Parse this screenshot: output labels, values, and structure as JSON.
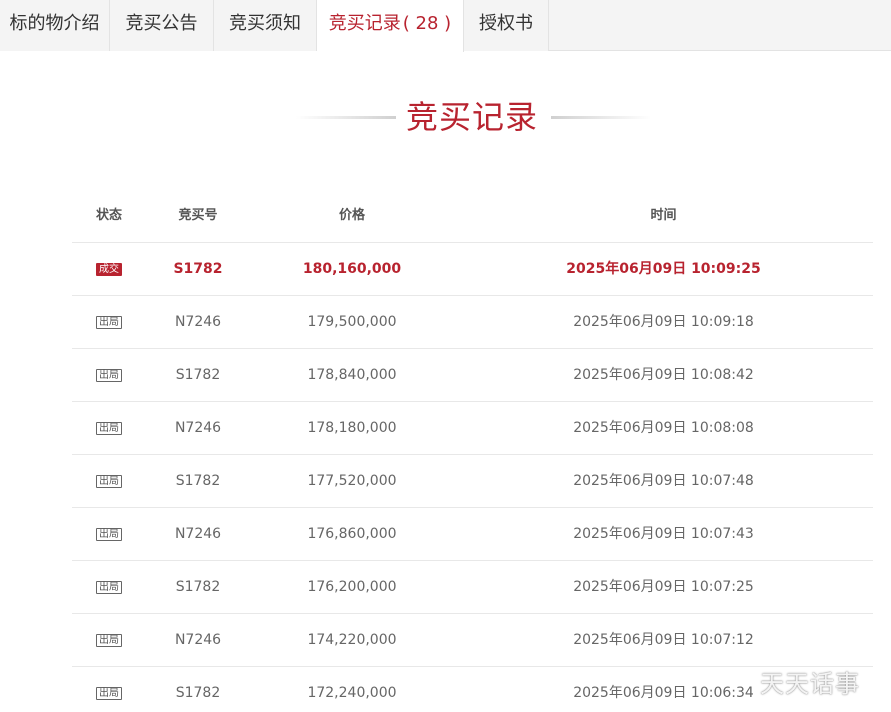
{
  "tabs": [
    {
      "label": "标的物介绍",
      "count": ""
    },
    {
      "label": "竞买公告",
      "count": ""
    },
    {
      "label": "竞买须知",
      "count": ""
    },
    {
      "label": "竞买记录",
      "count": "( 28 )"
    },
    {
      "label": "授权书",
      "count": ""
    }
  ],
  "active_tab": 3,
  "section_title": "竞买记录",
  "table": {
    "headers": {
      "status": "状态",
      "bid_no": "竞买号",
      "price": "价格",
      "time": "时间"
    },
    "rows": [
      {
        "status": "成交",
        "bid_no": "S1782",
        "price": "180,160,000",
        "time": "2025年06月09日 10:09:25"
      },
      {
        "status": "出局",
        "bid_no": "N7246",
        "price": "179,500,000",
        "time": "2025年06月09日 10:09:18"
      },
      {
        "status": "出局",
        "bid_no": "S1782",
        "price": "178,840,000",
        "time": "2025年06月09日 10:08:42"
      },
      {
        "status": "出局",
        "bid_no": "N7246",
        "price": "178,180,000",
        "time": "2025年06月09日 10:08:08"
      },
      {
        "status": "出局",
        "bid_no": "S1782",
        "price": "177,520,000",
        "time": "2025年06月09日 10:07:48"
      },
      {
        "status": "出局",
        "bid_no": "N7246",
        "price": "176,860,000",
        "time": "2025年06月09日 10:07:43"
      },
      {
        "status": "出局",
        "bid_no": "S1782",
        "price": "176,200,000",
        "time": "2025年06月09日 10:07:25"
      },
      {
        "status": "出局",
        "bid_no": "N7246",
        "price": "174,220,000",
        "time": "2025年06月09日 10:07:12"
      },
      {
        "status": "出局",
        "bid_no": "S1782",
        "price": "172,240,000",
        "time": "2025年06月09日 10:06:34"
      }
    ]
  },
  "watermark": "天天话事",
  "colors": {
    "accent": "#b8232f",
    "tab_bg": "#f4f4f4",
    "text": "#666666"
  }
}
